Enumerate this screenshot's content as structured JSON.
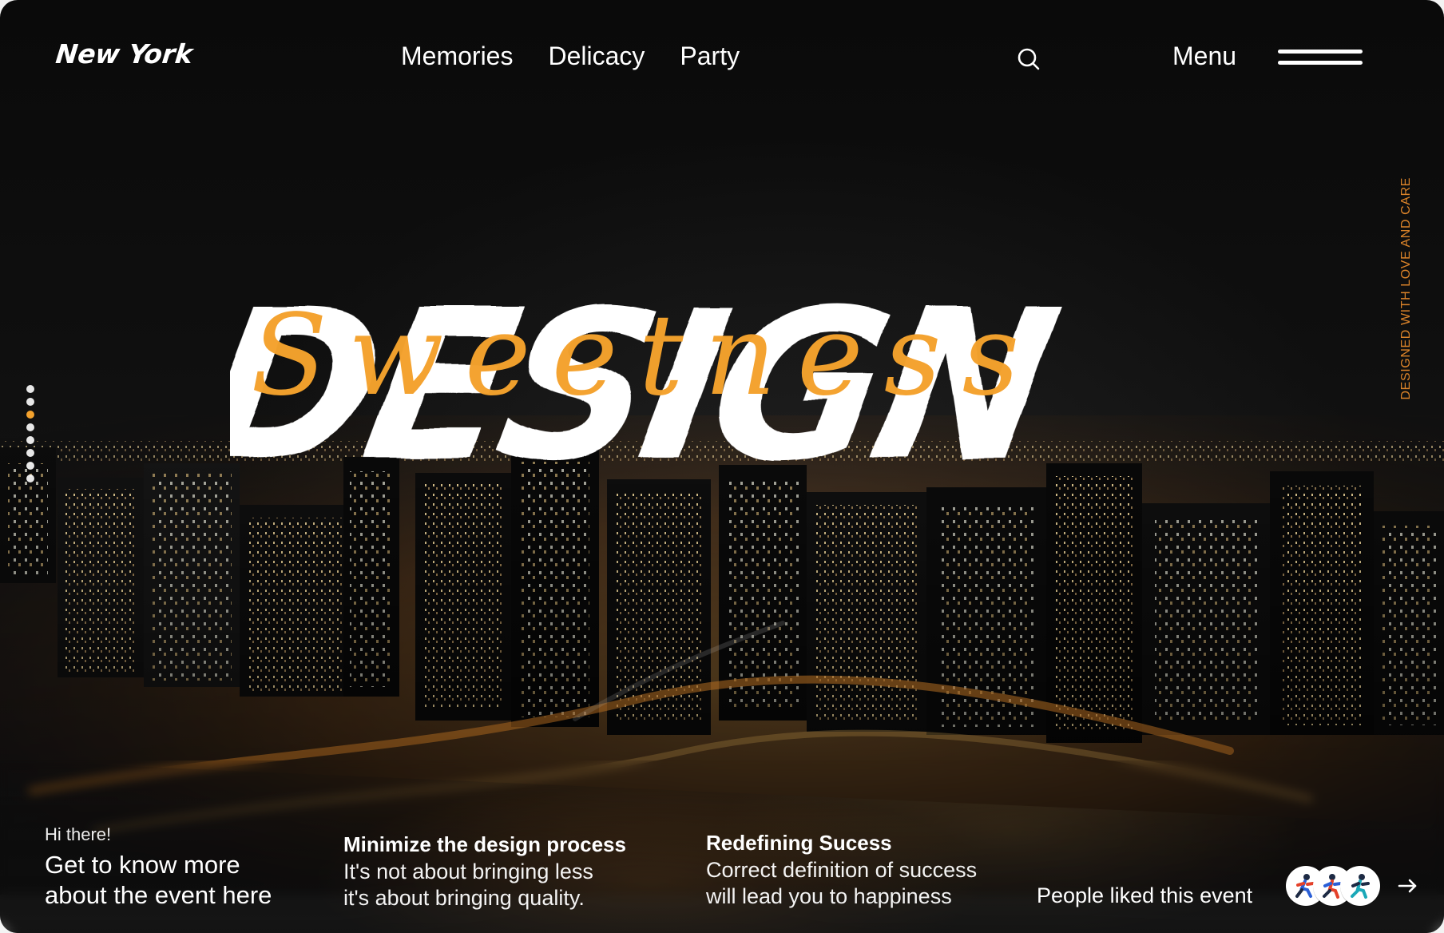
{
  "brand": {
    "text": "New York"
  },
  "nav": {
    "items": [
      "Memories",
      "Delicacy",
      "Party"
    ]
  },
  "header": {
    "menu_label": "Menu"
  },
  "hero": {
    "main_text": "DESIGN",
    "script_text": "Sweetness"
  },
  "side": {
    "vertical_text": "DESIGNED WITH LOVE AND CARE"
  },
  "bottom": {
    "greeting": {
      "small": "Hi there!",
      "big_line1": "Get to know more",
      "big_line2": "about the event here"
    },
    "minimize": {
      "title": "Minimize the design process",
      "body": "It's not about bringing less\nit's about bringing quality."
    },
    "redefining": {
      "title": "Redefining Sucess",
      "body": "Correct definition of success\nwill lead you to happiness"
    },
    "liked_text": "People liked this event"
  },
  "colors": {
    "accent": "#f4a22d",
    "vertical_text": "#e68a2b",
    "white": "#ffffff",
    "background": "#0f0f0f"
  },
  "icons": {
    "search": "search-icon",
    "menu": "hamburger-icon",
    "next": "arrow-right-icon"
  },
  "pagination": {
    "active_index": 2,
    "count": 8
  }
}
